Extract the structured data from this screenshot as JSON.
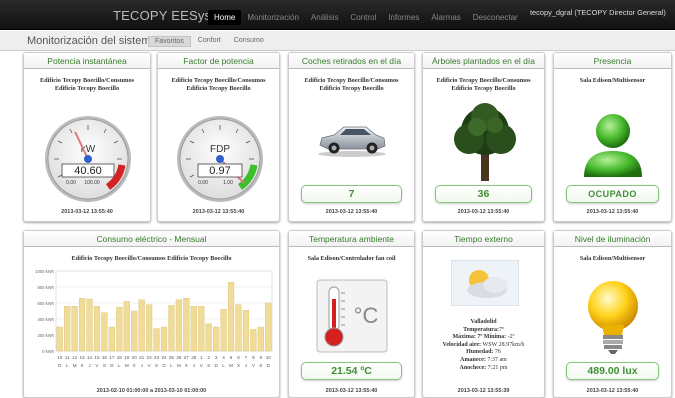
{
  "app": {
    "brand": "TECOPY EESystem",
    "user": "tecopy_dgral (TECOPY Director General)"
  },
  "nav": [
    "Home",
    "Monitorización",
    "Análisis",
    "Control",
    "Informes",
    "Alarmas",
    "Desconectar"
  ],
  "subheader": {
    "title": "Monitorización del sistema",
    "tabs": [
      "Favoritos",
      "Confort",
      "Consumo"
    ]
  },
  "panels": {
    "power": {
      "title": "Potencia instantánea",
      "subtitle1": "Edificio Tecopy Boecillo/Consumos",
      "subtitle2": "Edificio Tecopy Boecillo",
      "unit": "kW",
      "value": "40.60",
      "scale_min": "0.00",
      "scale_max": "100.00",
      "fraction": 0.406,
      "timestamp": "2013-03-12 13:55:40"
    },
    "pf": {
      "title": "Factor de potencia",
      "subtitle1": "Edificio Tecopy Boecillo/Consumos",
      "subtitle2": "Edificio Tecopy Boecillo",
      "unit": "FDP",
      "value": "0.97",
      "scale_min": "0.00",
      "scale_max": "1.00",
      "fraction": 0.97,
      "timestamp": "2013-03-12 13:55:40"
    },
    "cars": {
      "title": "Coches retirados en el día",
      "subtitle1": "Edificio Tecopy Boecillo/Consumos",
      "subtitle2": "Edificio Tecopy Boecillo",
      "value": "7",
      "timestamp": "2013-03-12 13:55:40"
    },
    "trees": {
      "title": "Árboles plantados en el día",
      "subtitle1": "Edificio Tecopy Boecillo/Consumos",
      "subtitle2": "Edificio Tecopy Boecillo",
      "value": "36",
      "timestamp": "2013-03-12 13:55:40"
    },
    "presence": {
      "title": "Presencia",
      "subtitle": "Sala Edison/Multisensor",
      "value": "OCUPADO",
      "timestamp": "2013-03-12 13:55:40"
    },
    "consumption": {
      "title": "Consumo eléctrico - Mensual",
      "subtitle": "Edificio Tecopy Boecillo/Consumos Edificio Tecopy Boecillo",
      "timestamp": "2013-02-10 01:00:00 a 2013-03-10 01:00:00"
    },
    "temperature": {
      "title": "Temperatura ambiente",
      "subtitle": "Sala Edison/Controlador fan coil",
      "value": "21.54 ºC",
      "timestamp": "2013-03-12 13:55:40"
    },
    "weather": {
      "title": "Tiempo externo",
      "city": "Valladolid",
      "lines": [
        [
          "Temperatura:",
          "7º"
        ],
        [
          "Máxima: 7º Mínima:",
          "-2º"
        ],
        [
          "Velocidad aire:",
          "WSW 28.97km/h"
        ],
        [
          "Humedad:",
          "76"
        ],
        [
          "Amanece:",
          "7:37 am"
        ],
        [
          "Anochece:",
          "7:21 pm"
        ]
      ],
      "timestamp": "2013-03-12 13:55:39"
    },
    "light": {
      "title": "Nivel de iluminación",
      "subtitle": "Sala Edison/Multisensor",
      "value": "489.00 lux",
      "timestamp": "2013-03-12 13:55:40"
    }
  },
  "chart_data": {
    "type": "bar",
    "ylim": [
      0,
      1000
    ],
    "yticks": [
      "1000 kWh",
      "800 kWh",
      "600 kWh",
      "400 kWh",
      "200 kWh",
      "0 kWh"
    ],
    "categories": [
      "10",
      "11",
      "12",
      "13",
      "14",
      "15",
      "16",
      "17",
      "18",
      "19",
      "20",
      "21",
      "22",
      "23",
      "24",
      "25",
      "26",
      "27",
      "28",
      "1",
      "2",
      "3",
      "4",
      "5",
      "6",
      "7",
      "8",
      "9",
      "10"
    ],
    "weekdays": [
      "D",
      "L",
      "M",
      "X",
      "J",
      "V",
      "S",
      "D",
      "L",
      "M",
      "X",
      "J",
      "V",
      "S",
      "D",
      "L",
      "M",
      "X",
      "J",
      "V",
      "S",
      "D",
      "L",
      "M",
      "X",
      "J",
      "V",
      "S",
      "D"
    ],
    "values": [
      300,
      560,
      560,
      660,
      650,
      560,
      480,
      300,
      550,
      620,
      500,
      640,
      580,
      280,
      300,
      570,
      640,
      660,
      560,
      560,
      340,
      300,
      520,
      860,
      580,
      510,
      270,
      300,
      600
    ],
    "bar_color": "#f0dc96"
  }
}
